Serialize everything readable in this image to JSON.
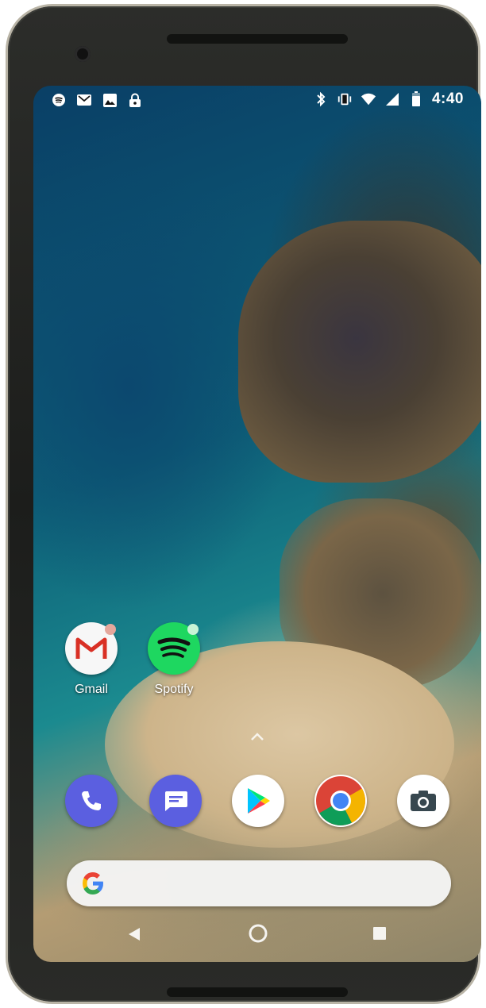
{
  "status_bar": {
    "left_icons": [
      "spotify-icon",
      "gmail-icon",
      "image-icon",
      "lock-icon"
    ],
    "right_icons": [
      "bluetooth-icon",
      "vibrate-icon",
      "wifi-icon",
      "signal-icon",
      "battery-icon"
    ],
    "time": "4:40"
  },
  "home_apps": [
    {
      "label": "Gmail",
      "icon": "gmail-icon",
      "has_badge": true
    },
    {
      "label": "Spotify",
      "icon": "spotify-icon",
      "has_badge": true
    }
  ],
  "dock": [
    {
      "icon": "phone-icon",
      "color": "#5b5fe0"
    },
    {
      "icon": "messages-icon",
      "color": "#5b5fe0"
    },
    {
      "icon": "play-store-icon",
      "color": "#ffffff"
    },
    {
      "icon": "chrome-icon",
      "color": "#ffffff"
    },
    {
      "icon": "camera-icon",
      "color": "#ffffff"
    }
  ],
  "search_bar": {
    "icon": "google-logo-icon"
  },
  "nav_bar": {
    "buttons": [
      "back-icon",
      "home-icon",
      "recents-icon"
    ]
  },
  "colors": {
    "spotify": "#1ed760",
    "gmail_red": "#d93025",
    "badge": "#e4a79c"
  }
}
